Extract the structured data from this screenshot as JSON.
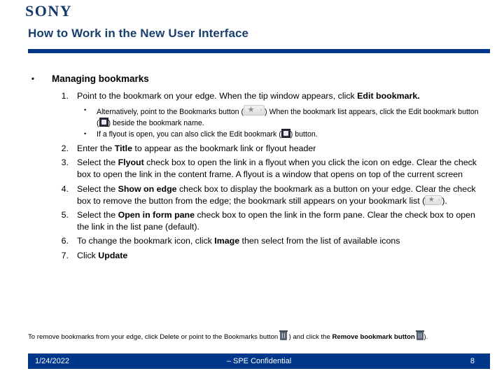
{
  "brand": "SONY",
  "header": {
    "title": "How to Work in the New User Interface",
    "rule_color": "#00378a"
  },
  "body": {
    "level1_bullet_glyph": "•",
    "level1_text": "Managing bookmarks",
    "steps": [
      {
        "num": "1.",
        "parts": [
          {
            "t": "Point to the bookmark on your edge.  When the tip window appears, click ",
            "b": false
          },
          {
            "t": "Edit bookmark.",
            "b": true
          }
        ],
        "substeps": [
          {
            "bullet": "•",
            "parts": [
              {
                "t": "Alternatively, point to the Bookmarks button (",
                "b": false
              },
              {
                "icon": "bookmarks-button-icon"
              },
              {
                "t": ") When the bookmark list appears, click the Edit bookmark button (",
                "b": false
              },
              {
                "icon": "edit-bookmark-button-icon"
              },
              {
                "t": ") beside the bookmark name.",
                "b": false
              }
            ]
          },
          {
            "bullet": "•",
            "parts": [
              {
                "t": "If a flyout is open, you can also click the Edit bookmark (",
                "b": false
              },
              {
                "icon": "edit-bookmark-button-icon"
              },
              {
                "t": ") button.",
                "b": false
              }
            ]
          }
        ]
      },
      {
        "num": "2.",
        "parts": [
          {
            "t": "Enter the ",
            "b": false
          },
          {
            "t": "Title",
            "b": true
          },
          {
            "t": " to appear as the bookmark link or flyout header",
            "b": false
          }
        ],
        "substeps": []
      },
      {
        "num": "3.",
        "parts": [
          {
            "t": "Select the ",
            "b": false
          },
          {
            "t": "Flyout",
            "b": true
          },
          {
            "t": " check box to open the link in a flyout when you click the icon on edge.  Clear the check box to open the link in the content frame.  A flyout is a window that opens on top of the current screen",
            "b": false
          }
        ],
        "substeps": []
      },
      {
        "num": "4.",
        "parts": [
          {
            "t": "Select the ",
            "b": false
          },
          {
            "t": "Show on edge",
            "b": true
          },
          {
            "t": " check box to display the bookmark as a button on your edge.  Clear the check box to remove the button from the edge; the bookmark still appears on your bookmark list (",
            "b": false
          },
          {
            "icon": "bookmarks-list-icon"
          },
          {
            "t": ").",
            "b": false
          }
        ],
        "substeps": []
      },
      {
        "num": "5.",
        "parts": [
          {
            "t": "Select the ",
            "b": false
          },
          {
            "t": "Open in form pane",
            "b": true
          },
          {
            "t": " check box to open the link in the form pane.  Clear the check box to open the link in the list pane (default).",
            "b": false
          }
        ],
        "substeps": []
      },
      {
        "num": "6.",
        "parts": [
          {
            "t": "To change the bookmark icon, click ",
            "b": false
          },
          {
            "t": "Image",
            "b": true
          },
          {
            "t": " then select from the list of available icons",
            "b": false
          }
        ],
        "substeps": []
      },
      {
        "num": "7.",
        "parts": [
          {
            "t": "Click ",
            "b": false
          },
          {
            "t": "Update",
            "b": true
          }
        ],
        "substeps": []
      }
    ]
  },
  "footnote": {
    "parts": [
      {
        "t": "To remove bookmarks from your edge, click Delete or point to the Bookmarks button ",
        "b": false
      },
      {
        "icon": "remove-bookmark-trash-icon"
      },
      {
        "t": " ) and click the ",
        "b": false
      },
      {
        "t": "Remove bookmark button ",
        "b": true
      },
      {
        "icon": "remove-bookmark-trash-icon"
      },
      {
        "t": ").",
        "b": false
      }
    ]
  },
  "footer": {
    "date": "1/24/2022",
    "center": "– SPE Confidential",
    "page": "8",
    "bar_color": "#00378a"
  }
}
